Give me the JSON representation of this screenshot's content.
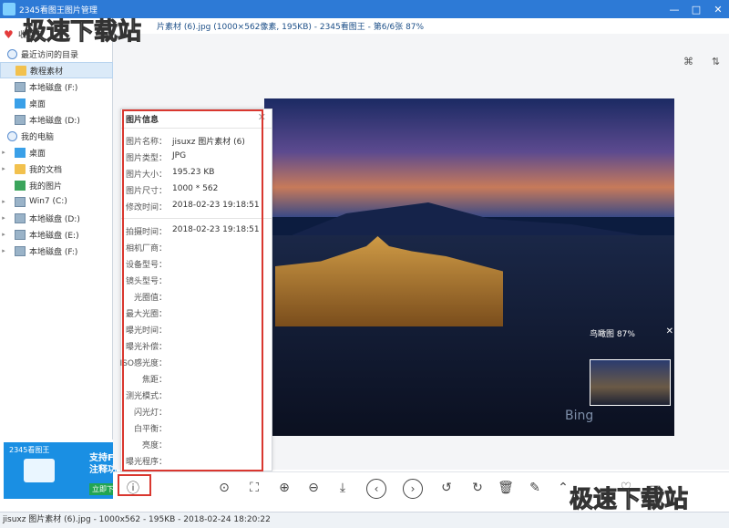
{
  "app": {
    "top_title": "2345看图王图片管理",
    "window_buttons": [
      "—",
      "□",
      "✕"
    ]
  },
  "viewer": {
    "title": "片素材 (6).jpg (1000×562像素, 195KB) - 2345看图王 - 第6/6张 87%",
    "tool_icons": [
      "rotate-icon",
      "sort-icon"
    ],
    "thumbnail_label": "鸟瞰图 87%",
    "bing_text": "Bing"
  },
  "watermark": {
    "top_text": "极速下载站",
    "bottom_text": "极速下载站"
  },
  "sidebar": {
    "header": "收藏夹",
    "items": [
      {
        "label": "最近访问的目录",
        "icon": "circle"
      },
      {
        "label": "教程素材",
        "icon": "folder"
      },
      {
        "label": "本地磁盘 (F:)",
        "icon": "drive"
      },
      {
        "label": "桌面",
        "icon": "desk"
      },
      {
        "label": "本地磁盘 (D:)",
        "icon": "drive"
      },
      {
        "label": "我的电脑",
        "icon": "circle"
      },
      {
        "label": "桌面",
        "icon": "desk"
      },
      {
        "label": "我的文档",
        "icon": "folder"
      },
      {
        "label": "我的图片",
        "icon": "pic"
      },
      {
        "label": "Win7 (C:)",
        "icon": "drive"
      },
      {
        "label": "本地磁盘 (D:)",
        "icon": "drive"
      },
      {
        "label": "本地磁盘 (E:)",
        "icon": "drive"
      },
      {
        "label": "本地磁盘 (F:)",
        "icon": "drive"
      }
    ]
  },
  "promo": {
    "title": "2345看图王",
    "line1": "支持F",
    "line2": "注释功",
    "button": "立即下"
  },
  "info_panel": {
    "title": "图片信息",
    "rows": [
      {
        "label": "图片名称：",
        "value": "jisuxz 图片素材 (6)"
      },
      {
        "label": "图片类型：",
        "value": "JPG"
      },
      {
        "label": "图片大小：",
        "value": "195.23 KB"
      },
      {
        "label": "图片尺寸：",
        "value": "1000 * 562"
      },
      {
        "label": "修改时间：",
        "value": "2018-02-23 19:18:51"
      },
      {
        "label": "拍摄时间：",
        "value": "2018-02-23 19:18:51"
      },
      {
        "label": "相机厂商：",
        "value": ""
      },
      {
        "label": "设备型号：",
        "value": ""
      },
      {
        "label": "镜头型号：",
        "value": ""
      },
      {
        "label": "光圈值：",
        "value": ""
      },
      {
        "label": "最大光圈：",
        "value": ""
      },
      {
        "label": "曝光时间：",
        "value": ""
      },
      {
        "label": "曝光补偿：",
        "value": ""
      },
      {
        "label": "ISO感光度：",
        "value": ""
      },
      {
        "label": "焦距：",
        "value": ""
      },
      {
        "label": "测光模式：",
        "value": ""
      },
      {
        "label": "闪光灯：",
        "value": ""
      },
      {
        "label": "白平衡：",
        "value": ""
      },
      {
        "label": "亮度：",
        "value": ""
      },
      {
        "label": "曝光程序：",
        "value": ""
      }
    ]
  },
  "toolbar": {
    "buttons": [
      {
        "name": "info",
        "glyph": "ⓘ"
      },
      {
        "name": "mouse-mode",
        "glyph": "⊙"
      },
      {
        "name": "fit-screen",
        "glyph": "⛶"
      },
      {
        "name": "zoom-in",
        "glyph": "⊕"
      },
      {
        "name": "zoom-out",
        "glyph": "⊖"
      },
      {
        "name": "download",
        "glyph": "⤓"
      },
      {
        "name": "previous",
        "glyph": "‹"
      },
      {
        "name": "next",
        "glyph": "›"
      },
      {
        "name": "rotate-left",
        "glyph": "↺"
      },
      {
        "name": "rotate-right",
        "glyph": "↻"
      },
      {
        "name": "delete",
        "glyph": "🗑"
      },
      {
        "name": "edit",
        "glyph": "✎"
      },
      {
        "name": "up",
        "glyph": "⌃"
      },
      {
        "name": "favorite",
        "glyph": "♡"
      },
      {
        "name": "folder",
        "glyph": "▭"
      }
    ]
  },
  "status_bar": {
    "text": "jisuxz 图片素材 (6).jpg - 1000x562 - 195KB - 2018-02-24 18:20:22"
  },
  "colors": {
    "title_bar": "#2d7ad6",
    "highlight_outline": "#d9372f",
    "promo_bg": "#1a8fe3"
  }
}
